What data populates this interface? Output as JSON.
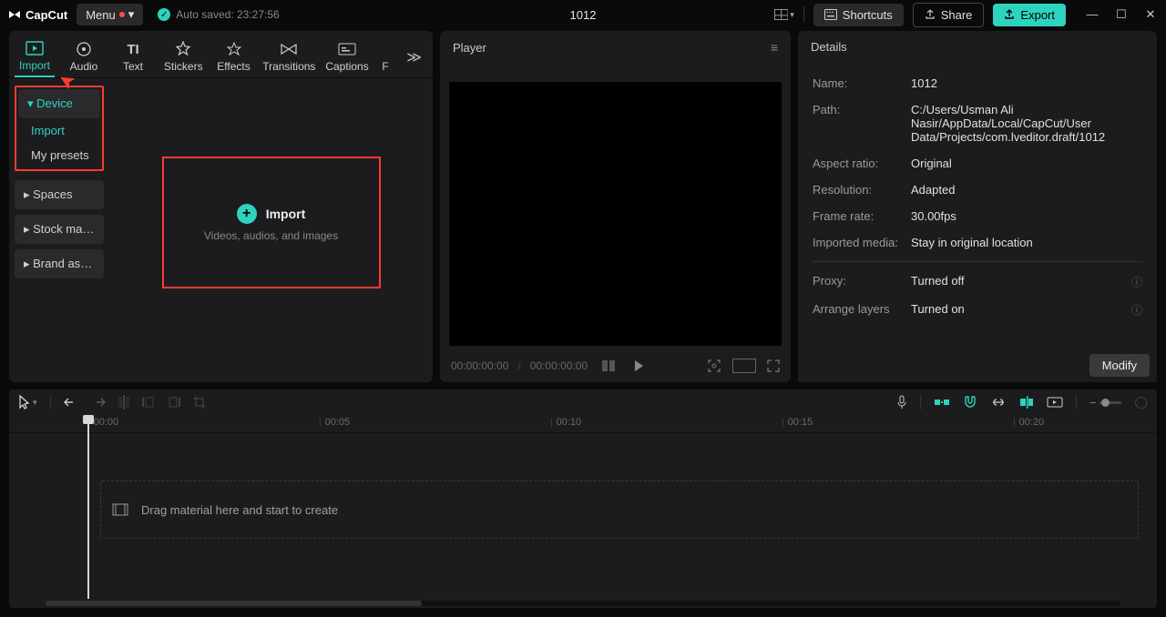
{
  "titlebar": {
    "app_name": "CapCut",
    "menu_label": "Menu",
    "autosave": "Auto saved: 23:27:56",
    "project_title": "1012",
    "shortcuts": "Shortcuts",
    "share": "Share",
    "export": "Export"
  },
  "tabs": {
    "items": [
      "Import",
      "Audio",
      "Text",
      "Stickers",
      "Effects",
      "Transitions",
      "Captions",
      "F"
    ],
    "active": 0
  },
  "sidebar": {
    "device": "Device",
    "import": "Import",
    "presets": "My presets",
    "spaces": "Spaces",
    "stock": "Stock mate...",
    "brand": "Brand assets"
  },
  "import_box": {
    "label": "Import",
    "sub": "Videos, audios, and images"
  },
  "player": {
    "title": "Player",
    "time_current": "00:00:00:00",
    "time_total": "00:00:00:00"
  },
  "details": {
    "title": "Details",
    "rows": {
      "name_k": "Name:",
      "name_v": "1012",
      "path_k": "Path:",
      "path_v": "C:/Users/Usman Ali Nasir/AppData/Local/CapCut/User Data/Projects/com.lveditor.draft/1012",
      "aspect_k": "Aspect ratio:",
      "aspect_v": "Original",
      "res_k": "Resolution:",
      "res_v": "Adapted",
      "fps_k": "Frame rate:",
      "fps_v": "30.00fps",
      "imp_k": "Imported media:",
      "imp_v": "Stay in original location",
      "proxy_k": "Proxy:",
      "proxy_v": "Turned off",
      "layers_k": "Arrange layers",
      "layers_v": "Turned on"
    },
    "modify": "Modify"
  },
  "timeline": {
    "ticks": [
      "00:00",
      "00:05",
      "00:10",
      "00:15",
      "00:20"
    ],
    "drop_msg": "Drag material here and start to create"
  }
}
